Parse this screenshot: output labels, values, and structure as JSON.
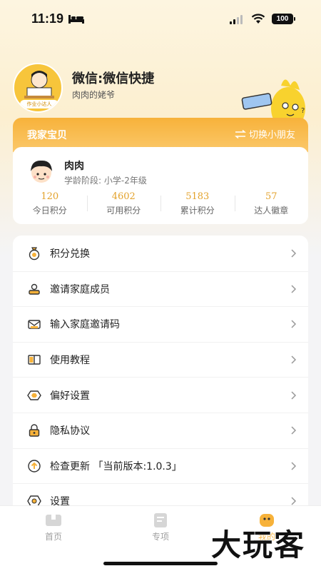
{
  "status_bar": {
    "time": "11:19",
    "battery": "100"
  },
  "profile": {
    "name": "微信:微信快捷",
    "subtitle": "肉肉的姥爷",
    "avatar_badge": "作业小达人"
  },
  "kid_section": {
    "title": "我家宝贝",
    "switch_label": "切换小朋友",
    "kid": {
      "name": "肉肉",
      "stage": "学龄阶段:  小学-2年级"
    },
    "stats": [
      {
        "value": "120",
        "label": "今日积分"
      },
      {
        "value": "4602",
        "label": "可用积分"
      },
      {
        "value": "5183",
        "label": "累计积分"
      },
      {
        "value": "57",
        "label": "达人徽章"
      }
    ]
  },
  "menu": {
    "items": [
      {
        "label": "积分兑换",
        "icon": "points-bag-icon"
      },
      {
        "label": "邀请家庭成员",
        "icon": "invite-member-icon"
      },
      {
        "label": "输入家庭邀请码",
        "icon": "invite-code-icon"
      },
      {
        "label": "使用教程",
        "icon": "tutorial-book-icon"
      },
      {
        "label": "偏好设置",
        "icon": "preference-icon"
      },
      {
        "label": "隐私协议",
        "icon": "lock-icon"
      },
      {
        "label": "检查更新 「当前版本:1.0.3」",
        "icon": "update-icon"
      },
      {
        "label": "设置",
        "icon": "settings-icon"
      }
    ]
  },
  "tabbar": {
    "tabs": [
      {
        "label": "首页"
      },
      {
        "label": "专项"
      },
      {
        "label": "我的"
      }
    ]
  },
  "watermark": "大玩客",
  "colors": {
    "accent": "#f7b23a",
    "stat_value": "#e3a22b"
  }
}
